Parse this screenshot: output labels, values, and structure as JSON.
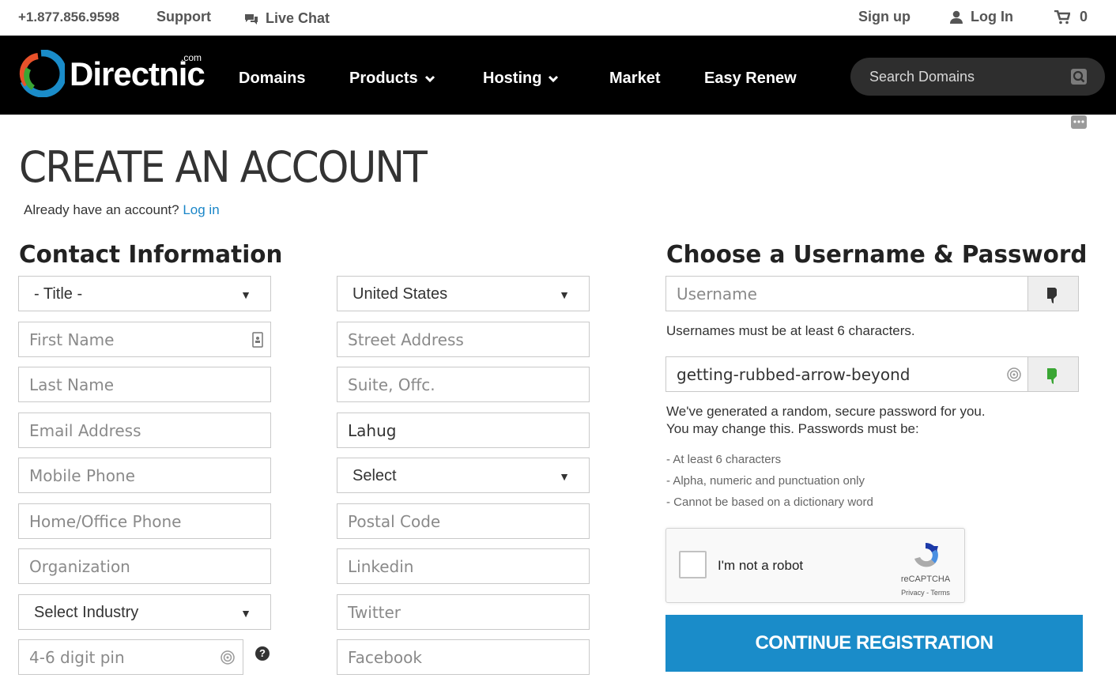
{
  "topbar": {
    "phone": "+1.877.856.9598",
    "support": "Support",
    "live_chat": "Live Chat",
    "sign_up": "Sign up",
    "log_in": "Log In",
    "cart_count": "0"
  },
  "nav": {
    "logo_text": "Directnic",
    "logo_suffix": ".com",
    "domains": "Domains",
    "products": "Products",
    "hosting": "Hosting",
    "market": "Market",
    "easy_renew": "Easy Renew",
    "search_placeholder": "Search Domains"
  },
  "page": {
    "title": "CREATE AN ACCOUNT",
    "already_text": "Already have an account?",
    "login_link": "Log in"
  },
  "contact": {
    "heading": "Contact Information",
    "title_select": "- Title -",
    "first_name": "First Name",
    "last_name": "Last Name",
    "email": "Email Address",
    "mobile": "Mobile Phone",
    "home_phone": "Home/Office Phone",
    "organization": "Organization",
    "industry_select": "Select Industry",
    "pin": "4-6 digit pin",
    "country_select": "United States",
    "street": "Street Address",
    "suite": "Suite, Offc.",
    "city_value": "Lahug",
    "state_select": "Select",
    "postal": "Postal Code",
    "linkedin": "Linkedin",
    "twitter": "Twitter",
    "facebook": "Facebook"
  },
  "account": {
    "heading": "Choose a Username & Password",
    "username_placeholder": "Username",
    "username_note": "Usernames must be at least 6 characters.",
    "password_value": "getting-rubbed-arrow-beyond",
    "password_note_1": "We've generated a random, secure password for you.",
    "password_note_2": "You may change this. Passwords must be:",
    "rules": [
      "- At least 6 characters",
      "- Alpha, numeric and punctuation only",
      "- Cannot be based on a dictionary word"
    ],
    "recaptcha_label": "I'm not a robot",
    "recaptcha_brand": "reCAPTCHA",
    "recaptcha_terms": "Privacy - Terms",
    "cta": "CONTINUE REGISTRATION"
  },
  "colors": {
    "nav_bg": "#000000",
    "accent_blue": "#1a8cc9",
    "link_blue": "#1a86c8",
    "valid_green": "#3aa634"
  }
}
